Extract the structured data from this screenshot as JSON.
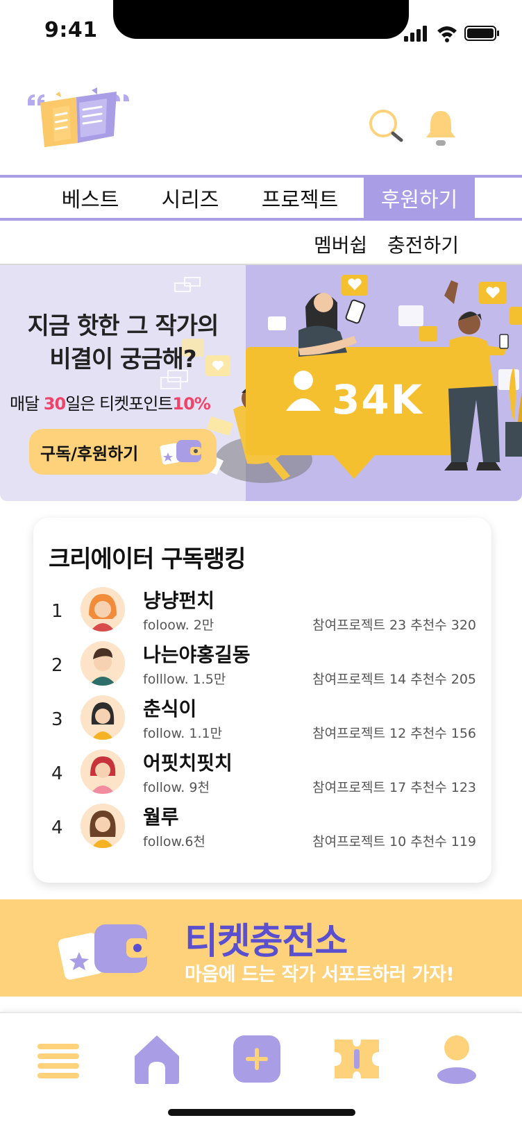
{
  "status_bar": {
    "time": "9:41"
  },
  "header": {
    "logo_icon": "book-logo-icon",
    "search_icon": "search-icon",
    "bell_icon": "bell-icon"
  },
  "main_nav": {
    "tabs": [
      {
        "label": "베스트",
        "active": false
      },
      {
        "label": "시리즈",
        "active": false
      },
      {
        "label": "프로젝트",
        "active": false
      },
      {
        "label": "후원하기",
        "active": true
      }
    ]
  },
  "sub_nav": {
    "items": [
      "멤버쉽",
      "충전하기"
    ]
  },
  "banner": {
    "headline_line1": "지금 핫한 그 작가의",
    "headline_line2": "비결이 궁금해?",
    "subline_pre": "매달 ",
    "subline_day": "30",
    "subline_mid": "일은 티켓포인트",
    "subline_pct": "10%",
    "button_label": "구독/후원하기",
    "counter": "34K"
  },
  "ranking": {
    "title": "크리에이터 구독랭킹",
    "rows": [
      {
        "rank": "1",
        "name": "냥냥펀치",
        "follow": "foloow. 2만",
        "stats": "참여프로젝트 23  추천수 320"
      },
      {
        "rank": "2",
        "name": "나는야홍길동",
        "follow": "folllow. 1.5만",
        "stats": "참여프로젝트 14  추천수 205"
      },
      {
        "rank": "3",
        "name": "춘식이",
        "follow": "follow. 1.1만",
        "stats": "참여프로젝트 12  추천수 156"
      },
      {
        "rank": "4",
        "name": "어핏치핏치",
        "follow": "follow. 9천",
        "stats": "참여프로젝트 17  추천수 123"
      },
      {
        "rank": "4",
        "name": "월루",
        "follow": "follow.6천",
        "stats": "참여프로젝트 10  추천수 119"
      }
    ]
  },
  "ticket_banner": {
    "title": "티켓충전소",
    "subtitle": "마음에 드는 작가 서포트하러 가자!"
  },
  "bottom_nav": {
    "items": [
      "menu-icon",
      "home-icon",
      "add-icon",
      "ticket-icon",
      "profile-icon"
    ]
  },
  "colors": {
    "accent_purple": "#a99ee6",
    "accent_yellow": "#fdd27a",
    "highlight_pink": "#f0436a",
    "ticket_title": "#5a4fcf"
  }
}
